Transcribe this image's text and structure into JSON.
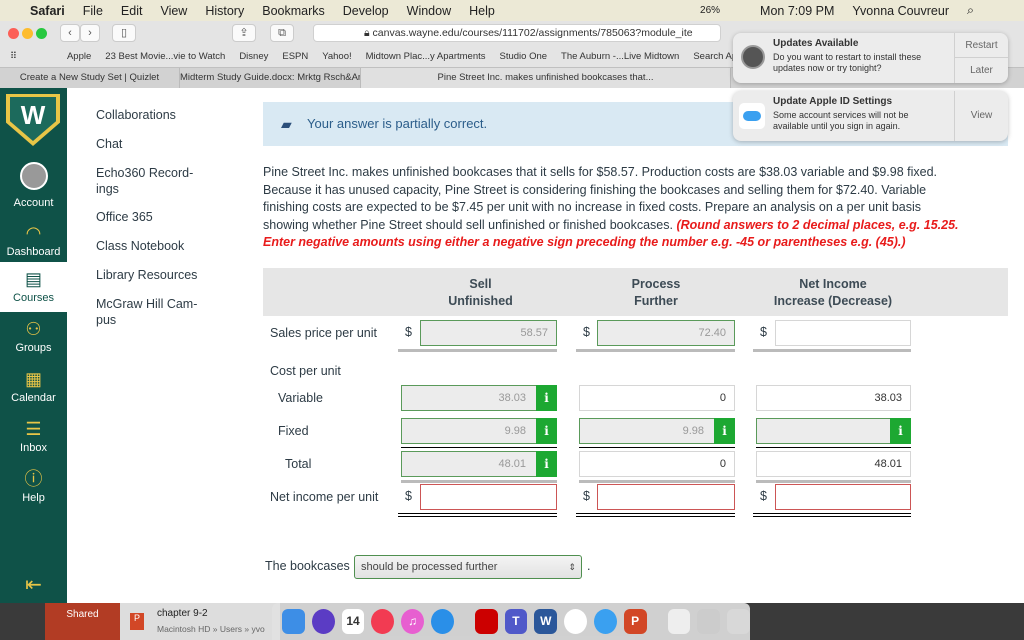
{
  "menubar": {
    "app": "Safari",
    "items": [
      "File",
      "Edit",
      "View",
      "History",
      "Bookmarks",
      "Develop",
      "Window",
      "Help"
    ],
    "battery": "26%",
    "clock": "Mon 7:09 PM",
    "user": "Yvonna Couvreur"
  },
  "browser": {
    "url": "canvas.wayne.edu/courses/111702/assignments/785063?module_ite",
    "bookmarks": [
      "Apple",
      "23 Best Movie...vie to Watch",
      "Disney",
      "ESPN",
      "Yahoo!",
      "Midtown Plac...y Apartments",
      "Studio One",
      "The Auburn -...Live Midtown",
      "Search Ap"
    ],
    "tabs": [
      "Create a New Study Set | Quizlet",
      "Midterm Study Guide.docx: Mrktg Rsch&Analysis S...",
      "Pine Street Inc. makes unfinished bookcases that..."
    ]
  },
  "notifications": [
    {
      "title": "Updates Available",
      "body": "Do you want to restart to install these updates now or try tonight?",
      "actions": [
        "Restart",
        "Later"
      ]
    },
    {
      "title": "Update Apple ID Settings",
      "body": "Some account services will not be available until you sign in again.",
      "actions": [
        "View"
      ]
    }
  ],
  "global_nav": [
    {
      "label": "Account",
      "icon": "avatar-icon"
    },
    {
      "label": "Dashboard",
      "icon": "dashboard-icon"
    },
    {
      "label": "Courses",
      "icon": "courses-icon",
      "active": true
    },
    {
      "label": "Groups",
      "icon": "groups-icon"
    },
    {
      "label": "Calendar",
      "icon": "calendar-icon"
    },
    {
      "label": "Inbox",
      "icon": "inbox-icon"
    },
    {
      "label": "Help",
      "icon": "help-icon"
    }
  ],
  "course_nav": [
    "Collaborations",
    "Chat",
    "Echo360 Record-ings",
    "Office 365",
    "Class Notebook",
    "Library Resources",
    "McGraw Hill Cam-pus"
  ],
  "banner": "Your answer is partially correct.",
  "prompt": {
    "text": "Pine Street Inc. makes unfinished bookcases that it sells for $58.57. Production costs are $38.03 variable and $9.98 fixed. Because it has unused capacity, Pine Street is considering finishing the bookcases and selling them for $72.40. Variable finishing costs are expected to be $7.45 per unit with no increase in fixed costs. Prepare an analysis on a per unit basis showing whether Pine Street should sell unfinished or finished bookcases. ",
    "instruction": "(Round answers to 2 decimal places, e.g. 15.25. Enter negative amounts using either a negative sign preceding the number e.g. -45 or parentheses e.g. (45).)"
  },
  "table": {
    "headers": [
      [
        "Sell",
        "Unfinished"
      ],
      [
        "Process",
        "Further"
      ],
      [
        "Net Income",
        "Increase (Decrease)"
      ]
    ],
    "currency": "$",
    "rows": {
      "sales": {
        "label": "Sales price per unit",
        "values": [
          "58.57",
          "72.40",
          ""
        ]
      },
      "cost": {
        "label": "Cost per unit"
      },
      "variable": {
        "label": "Variable",
        "values": [
          "38.03",
          "0",
          "38.03"
        ]
      },
      "fixed": {
        "label": "Fixed",
        "values": [
          "9.98",
          "9.98",
          ""
        ]
      },
      "total": {
        "label": "Total",
        "values": [
          "48.01",
          "0",
          "48.01"
        ]
      },
      "net": {
        "label": "Net income per unit",
        "values": [
          "",
          "",
          ""
        ]
      }
    },
    "info_glyph": "i"
  },
  "conclusion": {
    "prefix": "The bookcases",
    "selected": "should be processed further",
    "suffix": "."
  },
  "finder": {
    "shared": "Shared",
    "file": "chapter 9-2",
    "path": "Macintosh HD » Users » yvo"
  },
  "colors": {
    "sidebar": "#0f5248",
    "accent_gold": "#e8c547",
    "correct_green": "#1da832",
    "error_red": "#e81b1b"
  }
}
